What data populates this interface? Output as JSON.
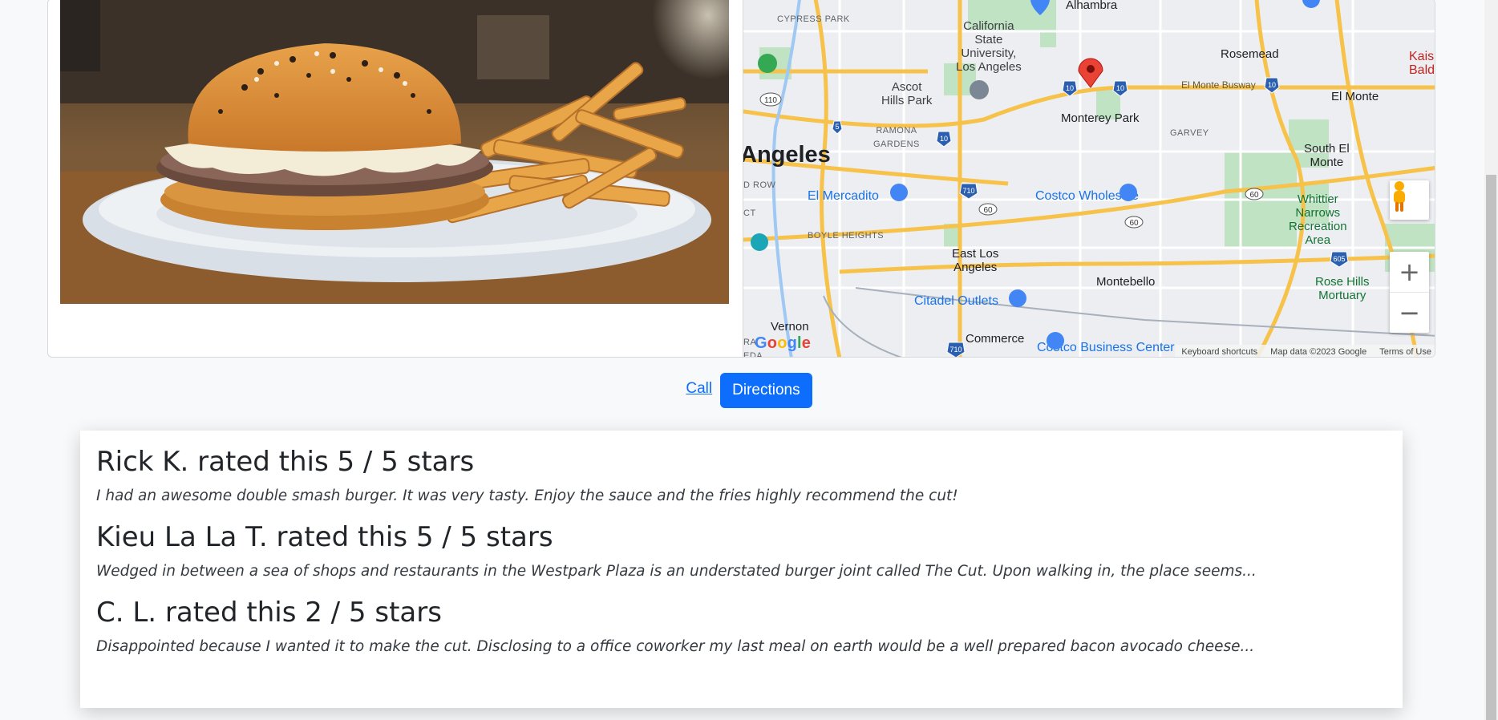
{
  "map": {
    "places": {
      "alhambra": "Alhambra",
      "cypress_park": "CYPRESS PARK",
      "csula": "California\nState\nUniversity,\nLos Angeles",
      "rosemead": "Rosemead",
      "el_monte": "El Monte",
      "kaiser": "Kais\nBaldwin",
      "el_monte_busway": "El Monte Busway",
      "ascot_hills": "Ascot\nHills Park",
      "monterey_park": "Monterey Park",
      "ramona_gardens": "RAMONA\nGARDENS",
      "garvey": "GARVEY",
      "south_el_monte": "South El\nMonte",
      "los_angeles": "Angeles",
      "el_mercadito": "El Mercadito",
      "costco_wholesale": "Costco Wholesale",
      "whittier_narrows": "Whittier\nNarrows\nRecreation\nArea",
      "boyle_heights": "BOYLE HEIGHTS",
      "d_row": "D ROW",
      "ct": "CT",
      "east_los_angeles": "East Los\nAngeles",
      "montebello": "Montebello",
      "rose_hills": "Rose Hills\nMortuary",
      "citadel_outlets": "Citadel Outlets",
      "vernon": "Vernon",
      "commerce": "Commerce",
      "costco_business": "Costco Business Center",
      "ra_eda": "RA\nEDA"
    },
    "shields": [
      "110",
      "5",
      "10",
      "710",
      "60",
      "605"
    ],
    "logo": "Google",
    "attribution": {
      "shortcuts": "Keyboard shortcuts",
      "data": "Map data ©2023 Google",
      "terms": "Terms of Use"
    },
    "zoom_in": "+",
    "zoom_out": "−",
    "icons": {
      "pegman": "pegman-icon",
      "pin": "location-pin-icon"
    }
  },
  "actions": {
    "call_label": "Call",
    "directions_label": "Directions"
  },
  "reviews": [
    {
      "title": "Rick K. rated this 5 / 5 stars",
      "text": "I had an awesome double smash burger. It was very tasty. Enjoy the sauce and the fries highly recommend the cut!"
    },
    {
      "title": "Kieu La La T. rated this 5 / 5 stars",
      "text": "Wedged in between a sea of shops and restaurants in the Westpark Plaza is an understated burger joint called The Cut. Upon walking in, the place seems..."
    },
    {
      "title": "C. L. rated this 2 / 5 stars",
      "text": "Disappointed because I wanted it to make the cut. Disclosing to a office coworker my last meal on earth would be a well prepared bacon avocado cheese..."
    }
  ],
  "colors": {
    "primary": "#0d6efd",
    "map_road": "#f5c04a",
    "map_park": "#b7dfbf",
    "pin": "#ea4335"
  }
}
